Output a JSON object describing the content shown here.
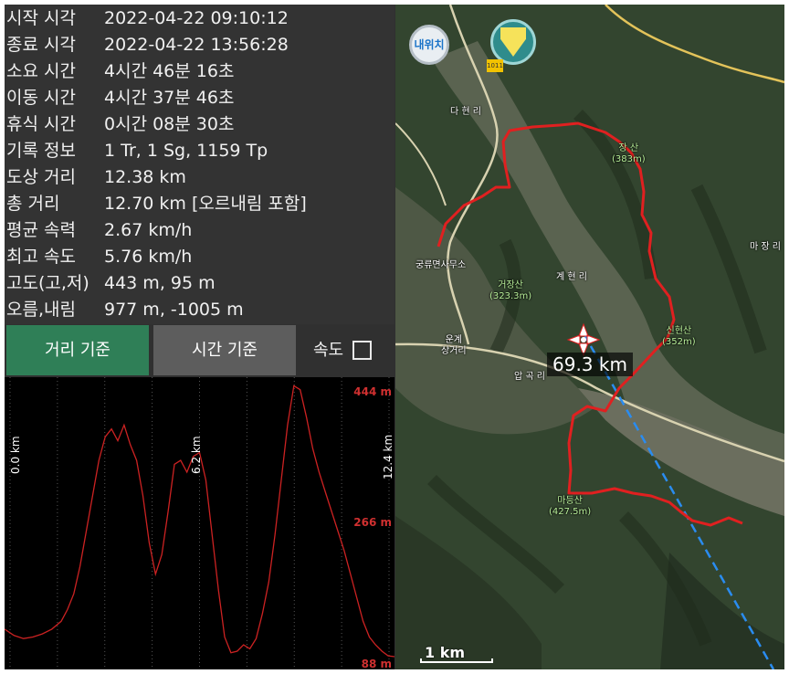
{
  "stats": [
    {
      "label": "시작 시각",
      "value": "2022-04-22 09:10:12"
    },
    {
      "label": "종료 시각",
      "value": "2022-04-22 13:56:28"
    },
    {
      "label": "소요 시간",
      "value": "4시간 46분 16초"
    },
    {
      "label": "이동 시간",
      "value": "4시간 37분 46초"
    },
    {
      "label": "휴식 시간",
      "value": "0시간 08분 30초"
    },
    {
      "label": "기록 정보",
      "value": "1 Tr, 1 Sg, 1159 Tp"
    },
    {
      "label": "도상 거리",
      "value": "12.38 km"
    },
    {
      "label": "총 거리",
      "value": "12.70 km [오르내림 포함]"
    },
    {
      "label": "평균 속력",
      "value": "2.67 km/h"
    },
    {
      "label": "최고 속도",
      "value": "5.76 km/h"
    },
    {
      "label": "고도(고,저)",
      "value": "443 m, 95 m"
    },
    {
      "label": "오름,내림",
      "value": "977 m, -1005 m"
    }
  ],
  "buttons": {
    "distance": "거리 기준",
    "time": "시간 기준",
    "speed": "속도",
    "speed_checked": false
  },
  "chart_data": {
    "type": "line",
    "x_ticks": [
      "0.0 km",
      "6.2 km",
      "12.4 km"
    ],
    "y_ticks": [
      "444 m",
      "266 m",
      "88 m"
    ],
    "ylim": [
      88,
      444
    ],
    "xlim": [
      0,
      12.4
    ],
    "line_color": "#cc2222",
    "x": [
      0.0,
      0.3,
      0.6,
      0.9,
      1.2,
      1.5,
      1.8,
      2.0,
      2.2,
      2.4,
      2.6,
      2.8,
      3.0,
      3.2,
      3.4,
      3.6,
      3.8,
      4.0,
      4.2,
      4.4,
      4.6,
      4.8,
      5.0,
      5.2,
      5.4,
      5.6,
      5.8,
      6.0,
      6.2,
      6.4,
      6.6,
      6.8,
      7.0,
      7.2,
      7.4,
      7.6,
      7.8,
      8.0,
      8.2,
      8.4,
      8.6,
      8.8,
      9.0,
      9.2,
      9.4,
      9.6,
      9.8,
      10.0,
      10.2,
      10.4,
      10.6,
      10.8,
      11.0,
      11.2,
      11.4,
      11.6,
      11.8,
      12.0,
      12.2,
      12.4
    ],
    "y": [
      130,
      122,
      118,
      120,
      124,
      130,
      140,
      155,
      175,
      210,
      255,
      300,
      345,
      375,
      385,
      370,
      390,
      365,
      345,
      300,
      240,
      200,
      225,
      280,
      340,
      345,
      330,
      350,
      355,
      320,
      250,
      180,
      120,
      100,
      102,
      110,
      105,
      118,
      150,
      190,
      250,
      320,
      390,
      440,
      435,
      400,
      360,
      330,
      305,
      280,
      255,
      230,
      200,
      170,
      140,
      120,
      110,
      102,
      96,
      95
    ]
  },
  "map": {
    "my_location_button": "내위치",
    "distance_label": "69.3 km",
    "scale_label": "1 km",
    "route_badge": "1011",
    "places": [
      {
        "name": "다 현 리",
        "kind": "village"
      },
      {
        "name": "궁류면사무소",
        "kind": "village"
      },
      {
        "name": "계 현 리",
        "kind": "village"
      },
      {
        "name": "마 장 리",
        "kind": "village"
      },
      {
        "name": "압 곡 리",
        "kind": "village"
      },
      {
        "name": "운계\n상거리",
        "kind": "village"
      },
      {
        "name": "장 산\n(383m)",
        "kind": "peak"
      },
      {
        "name": "거장산\n(323.3m)",
        "kind": "peak"
      },
      {
        "name": "신현산\n(352m)",
        "kind": "peak"
      },
      {
        "name": "마등산\n(427.5m)",
        "kind": "peak"
      }
    ],
    "route_color": "#e02020",
    "heading_line_color": "#2a8cf0"
  }
}
